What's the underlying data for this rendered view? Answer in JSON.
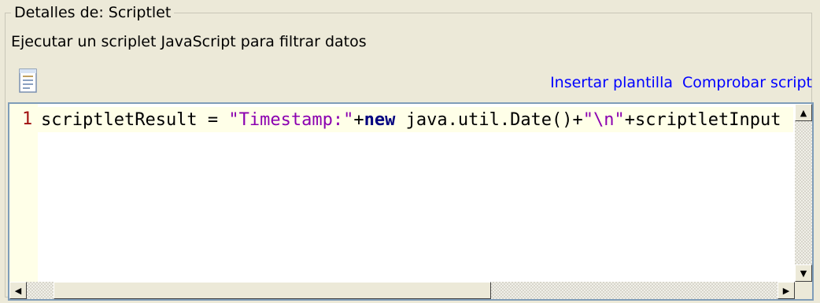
{
  "group": {
    "title": "Detalles de: Scriptlet",
    "description": "Ejecutar un scriplet JavaScript para filtrar datos"
  },
  "toolbar": {
    "template_icon": "document-icon",
    "insert_template_label": "Insertar plantilla",
    "check_script_label": "Comprobar script"
  },
  "editor": {
    "line_number": "1",
    "code_tokens": [
      {
        "text": "scriptletResult = ",
        "kind": "plain"
      },
      {
        "text": "\"Timestamp:\"",
        "kind": "string"
      },
      {
        "text": "+",
        "kind": "plain"
      },
      {
        "text": "new",
        "kind": "keyword"
      },
      {
        "text": " java.util.Date()+",
        "kind": "plain"
      },
      {
        "text": "\"\\n\"",
        "kind": "string"
      },
      {
        "text": "+scriptletInput",
        "kind": "plain"
      }
    ]
  },
  "scrollbars": {
    "up_arrow": "▲",
    "down_arrow": "▼",
    "left_arrow": "◀",
    "right_arrow": "▶"
  }
}
